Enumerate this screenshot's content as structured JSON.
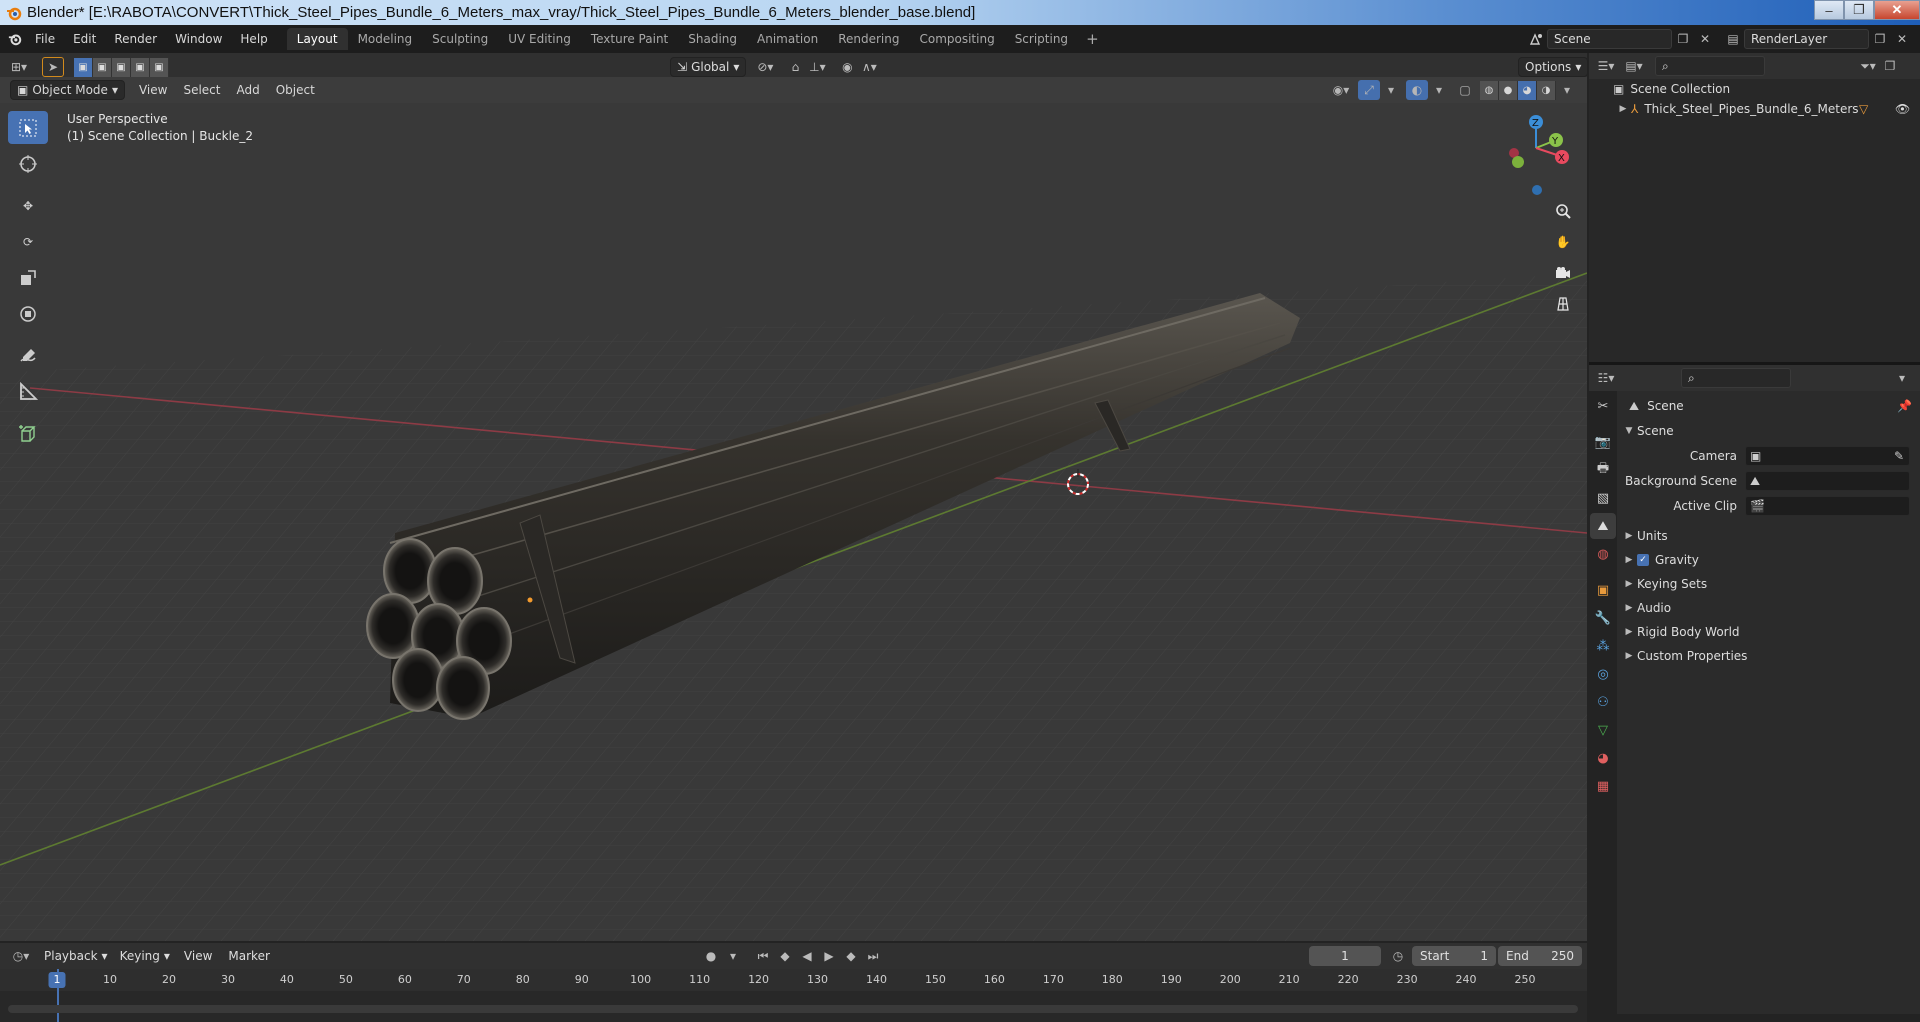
{
  "window": {
    "title": "Blender* [E:\\RABOTA\\CONVERT\\Thick_Steel_Pipes_Bundle_6_Meters_max_vray/Thick_Steel_Pipes_Bundle_6_Meters_blender_base.blend]",
    "buttons": [
      "–",
      "❐",
      "✕"
    ]
  },
  "menu": [
    "File",
    "Edit",
    "Render",
    "Window",
    "Help"
  ],
  "workspaces": [
    "Layout",
    "Modeling",
    "Sculpting",
    "UV Editing",
    "Texture Paint",
    "Shading",
    "Animation",
    "Rendering",
    "Compositing",
    "Scripting"
  ],
  "active_workspace": "Layout",
  "scene_selector": "Scene",
  "view_layer": "RenderLayer",
  "tool_header": {
    "orientation": "Global",
    "options": "Options"
  },
  "viewport_header": {
    "mode": "Object Mode",
    "menus": [
      "View",
      "Select",
      "Add",
      "Object"
    ]
  },
  "viewport": {
    "perspective": "User Perspective",
    "collection_info": "(1) Scene Collection | Buckle_2",
    "gizmo_axes": [
      "Z",
      "Y",
      "X"
    ]
  },
  "outliner": {
    "root": "Scene Collection",
    "items": [
      "Thick_Steel_Pipes_Bundle_6_Meters"
    ]
  },
  "properties": {
    "context": "Scene",
    "panel": "Scene",
    "fields": [
      {
        "label": "Camera",
        "value": ""
      },
      {
        "label": "Background Scene",
        "value": ""
      },
      {
        "label": "Active Clip",
        "value": ""
      }
    ],
    "subpanels": [
      "Units",
      "Gravity",
      "Keying Sets",
      "Audio",
      "Rigid Body World",
      "Custom Properties"
    ],
    "gravity_enabled": true
  },
  "timeline": {
    "menus": [
      "Playback",
      "Keying",
      "View",
      "Marker"
    ],
    "current_frame": "1",
    "start_label": "Start",
    "start": "1",
    "end_label": "End",
    "end": "250",
    "ruler": [
      "1",
      "10",
      "20",
      "30",
      "40",
      "50",
      "60",
      "70",
      "80",
      "90",
      "100",
      "110",
      "120",
      "130",
      "140",
      "150",
      "160",
      "170",
      "180",
      "190",
      "200",
      "210",
      "220",
      "230",
      "240",
      "250"
    ]
  },
  "colors": {
    "accent": "#4772b3",
    "x_axis": "#e84a5f",
    "y_axis": "#8bc34a",
    "z_axis": "#3b8ed8"
  }
}
